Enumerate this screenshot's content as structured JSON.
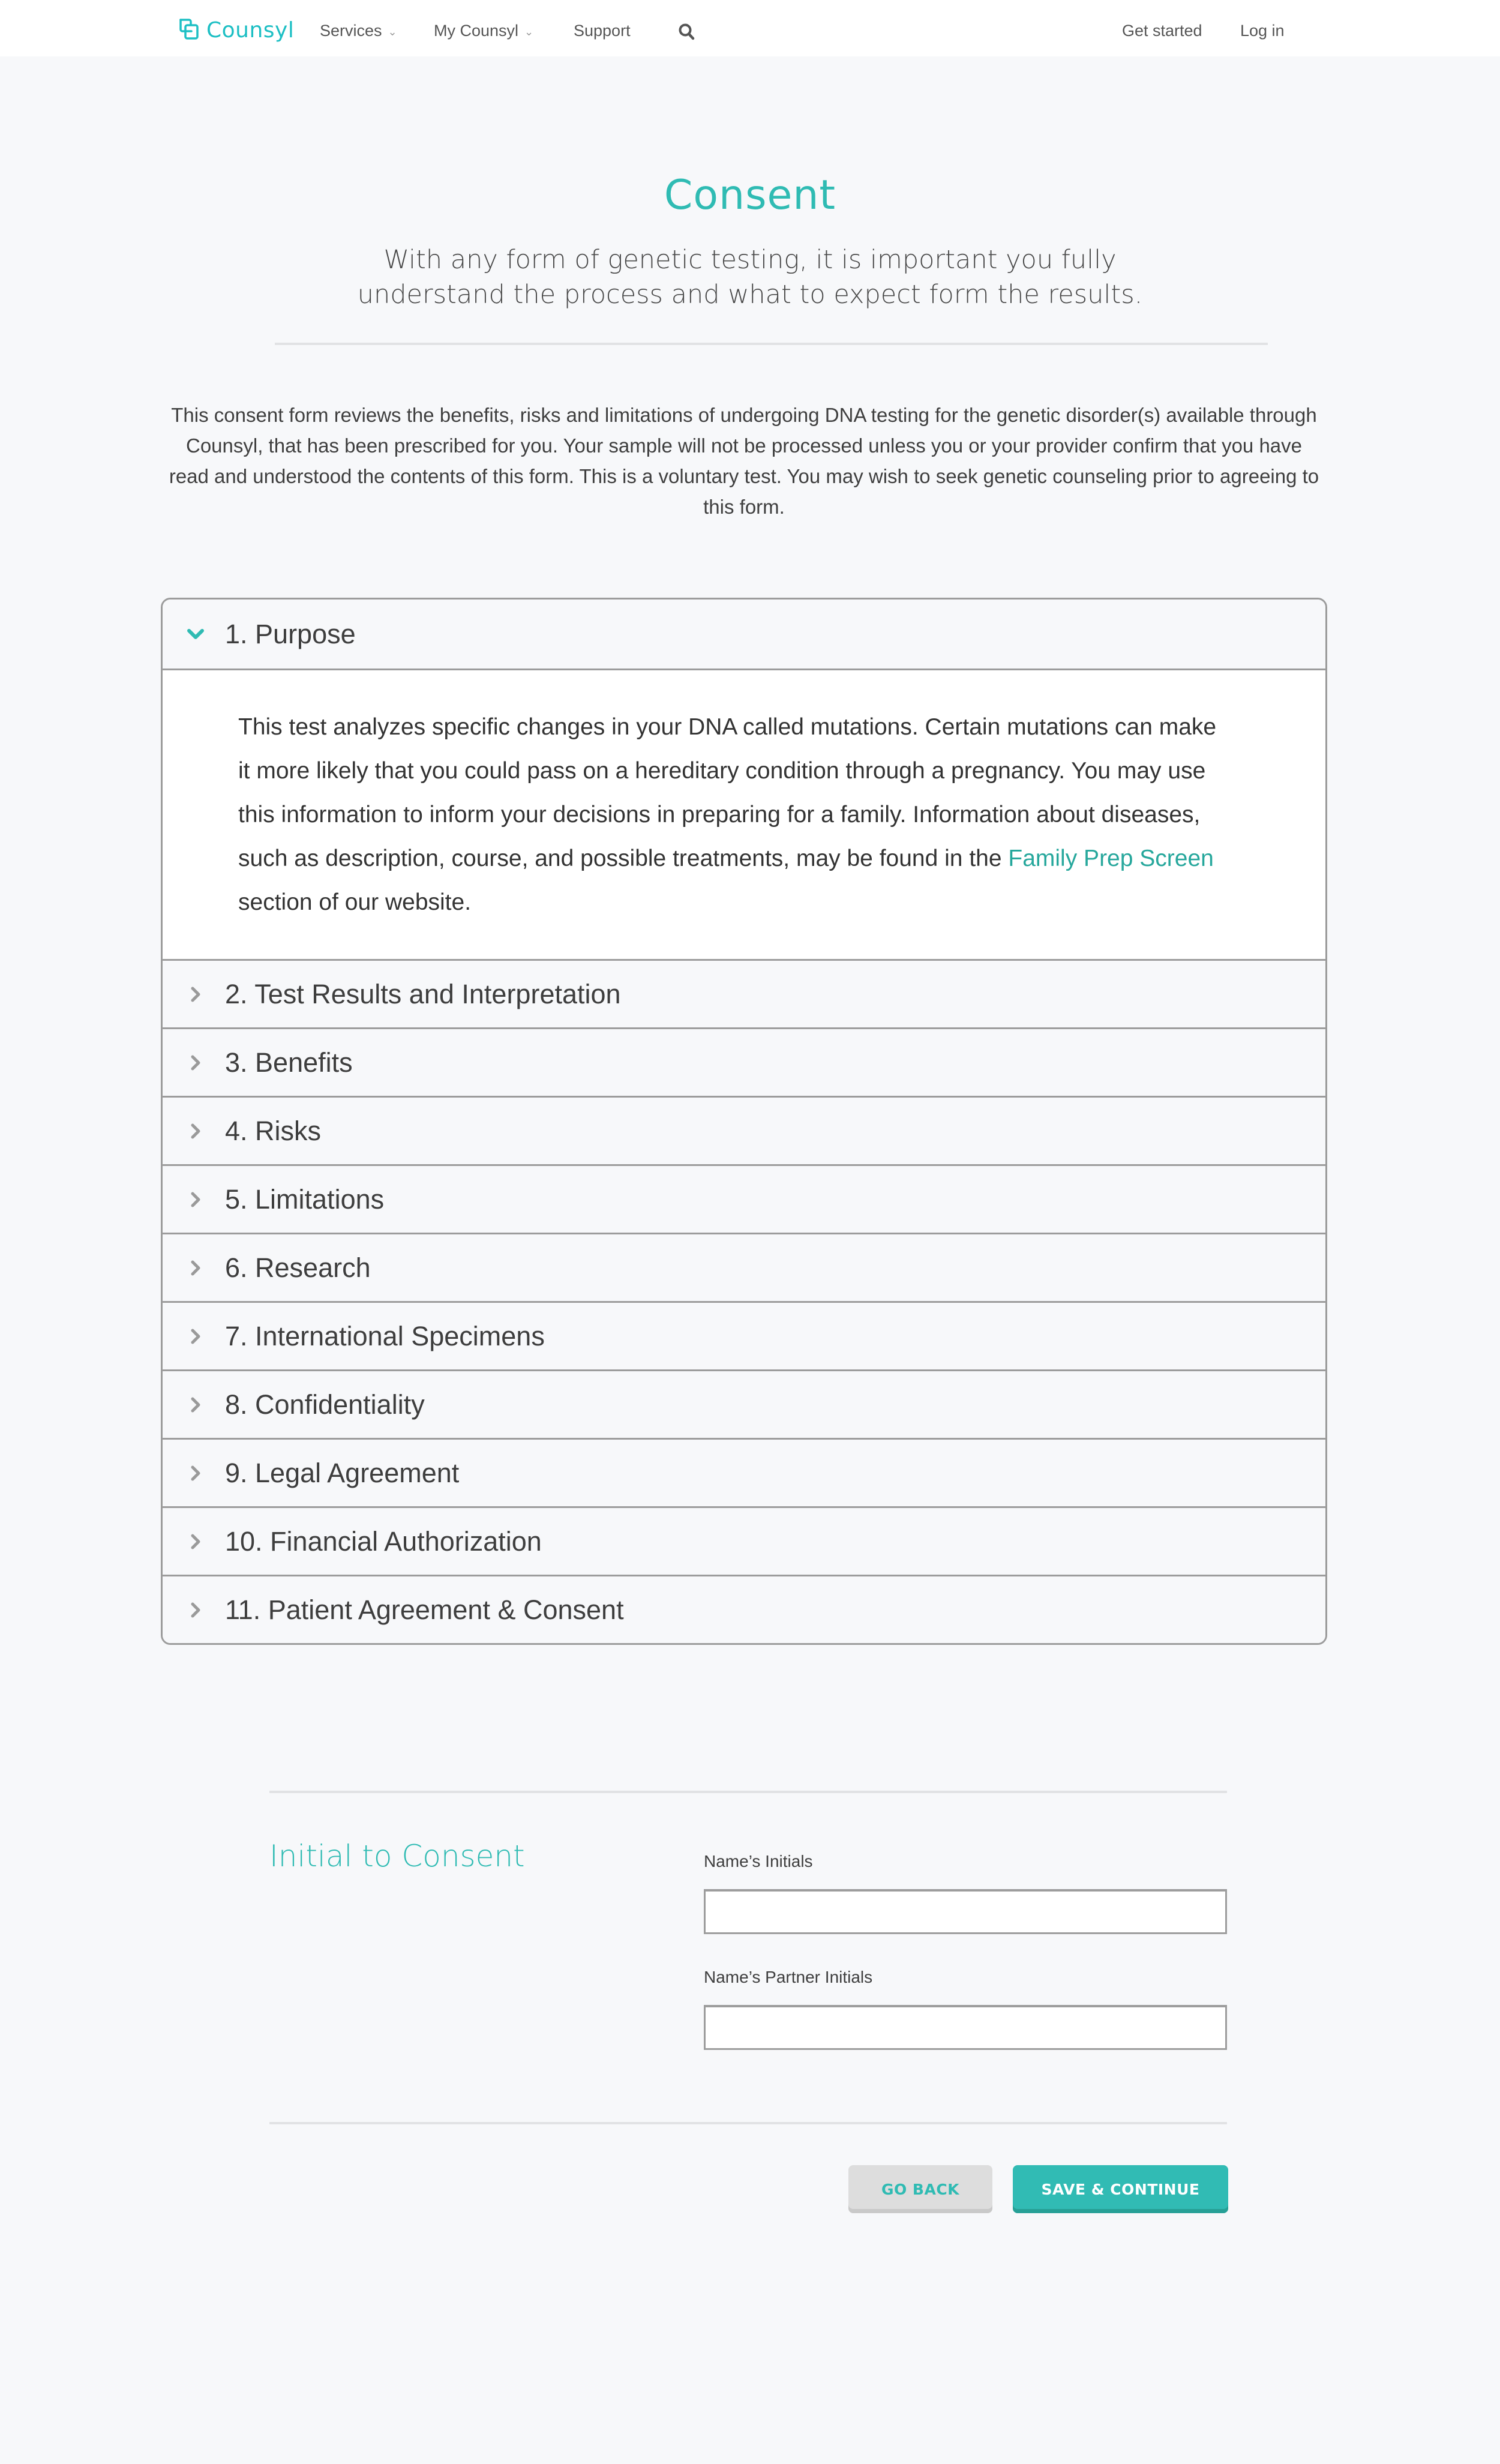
{
  "nav": {
    "logo_text": "Counsyl",
    "items": [
      {
        "label": "Services",
        "has_dropdown": true
      },
      {
        "label": "My Counsyl",
        "has_dropdown": true
      },
      {
        "label": "Support",
        "has_dropdown": false
      }
    ],
    "search_icon": "search-icon",
    "get_started": "Get started",
    "log_in": "Log in",
    "dropdown_glyph": "⌄"
  },
  "hero": {
    "title": "Consent",
    "subtitle_line1": "With any form of genetic testing, it is important you fully",
    "subtitle_line2": "understand the process and what to expect form the results."
  },
  "intro": {
    "text": "This consent form reviews the benefits, risks and limitations of undergoing DNA testing for the genetic disorder(s) available through Counsyl, that has been prescribed for you. Your sample will not be processed unless you or your provider confirm that you have read and understood the contents of this form. This is a voluntary test. You may wish to seek genetic counseling prior to agreeing to this form."
  },
  "accordion": {
    "sections": [
      {
        "title": "1. Purpose",
        "expanded": true
      },
      {
        "title": "2. Test Results and Interpretation",
        "expanded": false
      },
      {
        "title": "3. Benefits",
        "expanded": false
      },
      {
        "title": "4. Risks",
        "expanded": false
      },
      {
        "title": "5. Limitations",
        "expanded": false
      },
      {
        "title": "6. Research",
        "expanded": false
      },
      {
        "title": "7. International Specimens",
        "expanded": false
      },
      {
        "title": "8. Confidentiality",
        "expanded": false
      },
      {
        "title": "9. Legal Agreement",
        "expanded": false
      },
      {
        "title": "10. Financial Authorization",
        "expanded": false
      },
      {
        "title": "11. Patient Agreement & Consent",
        "expanded": false
      }
    ],
    "purpose_body": {
      "text_before_link": "This test analyzes specific changes in your DNA called mutations. Certain mutations can make it more likely that you could pass on a hereditary condition through a pregnancy. You may use this information to inform your decisions in preparing for a family. Information about diseases, such as description, course, and possible treatments, may be found in the ",
      "link_text": "Family Prep Screen",
      "text_after_link": " section of our website."
    }
  },
  "initials": {
    "title": "Initial to Consent",
    "name_label": "Name’s Initials",
    "name_value": "",
    "partner_label": "Name’s Partner Initials",
    "partner_value": ""
  },
  "actions": {
    "go_back": "GO BACK",
    "save_continue": "SAVE & CONTINUE"
  },
  "colors": {
    "brand_teal": "#2fbbb3",
    "logo_teal": "#1dbfc4",
    "link_teal": "#26a79c",
    "background": "#f7f8fa",
    "border_gray": "#9c9c9c",
    "button_gray": "#dddddd"
  }
}
